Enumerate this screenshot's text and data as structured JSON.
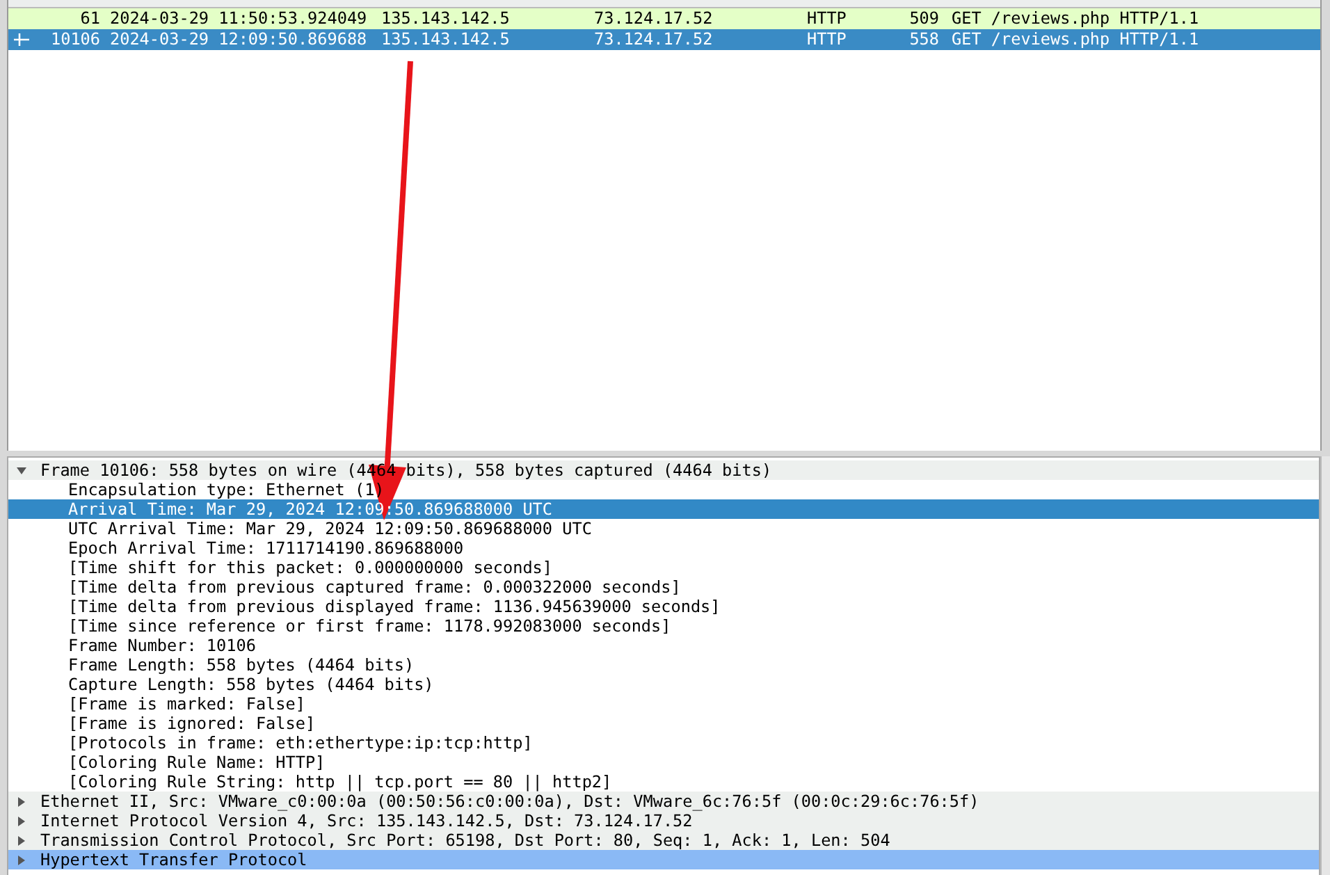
{
  "packet_list": {
    "rows": [
      {
        "no": "61",
        "time": "2024-03-29 11:50:53.924049",
        "source": "135.143.142.5",
        "destination": "73.124.17.52",
        "protocol": "HTTP",
        "length": "509",
        "info": "GET /reviews.php HTTP/1.1",
        "selected": false,
        "related": false,
        "color": "#e4ffc7"
      },
      {
        "no": "10106",
        "time": "2024-03-29 12:09:50.869688",
        "source": "135.143.142.5",
        "destination": "73.124.17.52",
        "protocol": "HTTP",
        "length": "558",
        "info": "GET /reviews.php HTTP/1.1",
        "selected": true,
        "related": true
      }
    ]
  },
  "details": {
    "items": [
      {
        "text": "Frame 10106: 558 bytes on wire (4464 bits), 558 bytes captured (4464 bits)",
        "expanded": true,
        "selected": false,
        "highlighted": false,
        "children": [
          {
            "text": "Encapsulation type: Ethernet (1)",
            "selected": false,
            "highlighted": false
          },
          {
            "text": "Arrival Time: Mar 29, 2024 12:09:50.869688000 UTC",
            "selected": true,
            "highlighted": false
          },
          {
            "text": "UTC Arrival Time: Mar 29, 2024 12:09:50.869688000 UTC",
            "selected": false,
            "highlighted": false
          },
          {
            "text": "Epoch Arrival Time: 1711714190.869688000",
            "selected": false,
            "highlighted": false
          },
          {
            "text": "[Time shift for this packet: 0.000000000 seconds]",
            "selected": false,
            "highlighted": false
          },
          {
            "text": "[Time delta from previous captured frame: 0.000322000 seconds]",
            "selected": false,
            "highlighted": false
          },
          {
            "text": "[Time delta from previous displayed frame: 1136.945639000 seconds]",
            "selected": false,
            "highlighted": false
          },
          {
            "text": "[Time since reference or first frame: 1178.992083000 seconds]",
            "selected": false,
            "highlighted": false
          },
          {
            "text": "Frame Number: 10106",
            "selected": false,
            "highlighted": false
          },
          {
            "text": "Frame Length: 558 bytes (4464 bits)",
            "selected": false,
            "highlighted": false
          },
          {
            "text": "Capture Length: 558 bytes (4464 bits)",
            "selected": false,
            "highlighted": false
          },
          {
            "text": "[Frame is marked: False]",
            "selected": false,
            "highlighted": false
          },
          {
            "text": "[Frame is ignored: False]",
            "selected": false,
            "highlighted": false
          },
          {
            "text": "[Protocols in frame: eth:ethertype:ip:tcp:http]",
            "selected": false,
            "highlighted": false
          },
          {
            "text": "[Coloring Rule Name: HTTP]",
            "selected": false,
            "highlighted": false
          },
          {
            "text": "[Coloring Rule String: http || tcp.port == 80 || http2]",
            "selected": false,
            "highlighted": false
          }
        ]
      },
      {
        "text": "Ethernet II, Src: VMware_c0:00:0a (00:50:56:c0:00:0a), Dst: VMware_6c:76:5f (00:0c:29:6c:76:5f)",
        "expanded": false,
        "selected": false,
        "highlighted": false
      },
      {
        "text": "Internet Protocol Version 4, Src: 135.143.142.5, Dst: 73.124.17.52",
        "expanded": false,
        "selected": false,
        "highlighted": false
      },
      {
        "text": "Transmission Control Protocol, Src Port: 65198, Dst Port: 80, Seq: 1, Ack: 1, Len: 504",
        "expanded": false,
        "selected": false,
        "highlighted": false
      },
      {
        "text": "Hypertext Transfer Protocol",
        "expanded": false,
        "selected": false,
        "highlighted": true
      }
    ]
  }
}
